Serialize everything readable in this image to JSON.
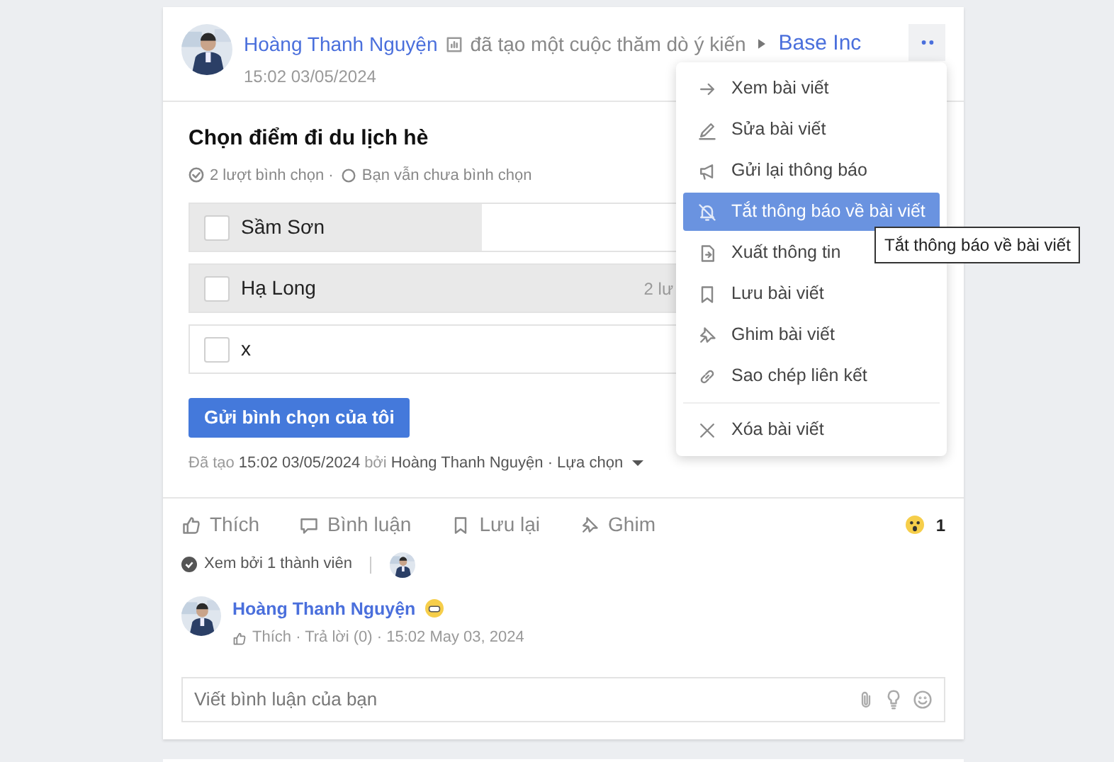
{
  "post": {
    "author": "Hoàng Thanh Nguyện",
    "action": "đã tạo một cuộc thăm dò ý kiến",
    "group": "Base Inc",
    "time": "15:02 03/05/2024"
  },
  "poll": {
    "title": "Chọn điểm đi du lịch hè",
    "votes": "2 lượt bình chọn ·",
    "status": "Bạn vẫn chưa bình chọn",
    "options": [
      {
        "label": "Sầm Sơn",
        "checked": false,
        "level": 0.39
      },
      {
        "label": "Hạ Long",
        "checked": false,
        "level": 1,
        "count": "2 lư"
      },
      {
        "label": "x",
        "checked": false,
        "level": 0
      }
    ],
    "submit": "Gửi bình chọn của tôi",
    "created_label": "Đã tạo",
    "created_time": "15:02 03/05/2024",
    "by": "bởi",
    "creator": "Hoàng Thanh Nguyện · Lựa chọn"
  },
  "actions": [
    {
      "kind": "like",
      "label": "Thích"
    },
    {
      "kind": "comment",
      "label": "Bình luận"
    },
    {
      "kind": "save",
      "label": "Lưu lại"
    },
    {
      "kind": "pin",
      "label": "Ghim"
    }
  ],
  "reaction_count": "1",
  "seen": "Xem bởi 1 thành viên",
  "comment": {
    "author": "Hoàng Thanh Nguyện",
    "meta": "Thích · Trả lời (0) · 15:02 May 03, 2024"
  },
  "comment_field": {
    "placeholder": "Viết bình luận của bạn"
  },
  "menu": [
    {
      "kind": "arrow",
      "label": "Xem bài viết",
      "selected": false
    },
    {
      "kind": "pencil",
      "label": "Sửa bài viết",
      "selected": false
    },
    {
      "kind": "megaphone",
      "label": "Gửi lại thông báo",
      "selected": false
    },
    {
      "kind": "bell-off",
      "label": "Tắt thông báo về bài viết",
      "selected": true
    },
    {
      "kind": "export",
      "label": "Xuất thông tin",
      "selected": false
    },
    {
      "kind": "bookmark",
      "label": "Lưu bài viết",
      "selected": false
    },
    {
      "kind": "pin",
      "label": "Ghim bài viết",
      "selected": false
    },
    {
      "kind": "link",
      "label": "Sao chép liên kết",
      "selected": false
    },
    {
      "kind": "close",
      "label": "Xóa bài viết",
      "selected": false
    }
  ],
  "tooltip": "Tắt thông báo về bài viết"
}
